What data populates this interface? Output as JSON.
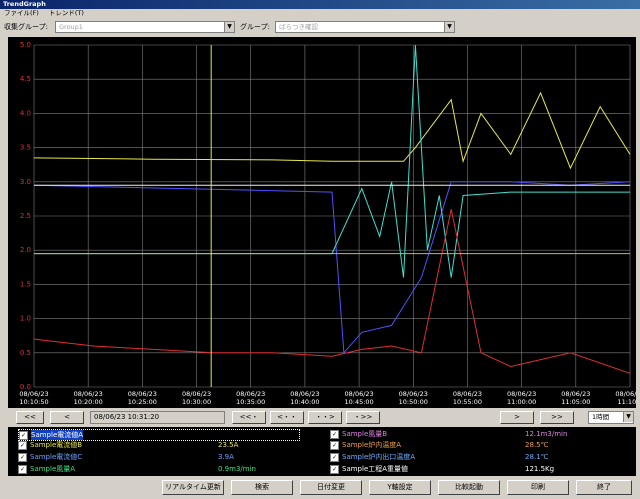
{
  "window": {
    "title": "TrendGraph"
  },
  "menu": [
    "ファイル(F)",
    "トレンド(T)"
  ],
  "toolbar": {
    "collect_group_label": "収集グループ:",
    "collect_group_value": "Group1",
    "group_label": "グループ:",
    "group_value": "ばらつき確認"
  },
  "chart_data": {
    "type": "line",
    "ylim": [
      0,
      5.0
    ],
    "yticks": [
      "0.0",
      "0.5",
      "1.0",
      "1.5",
      "2.0",
      "2.5",
      "3.0",
      "3.5",
      "4.0",
      "4.5",
      "5.0"
    ],
    "xticks": [
      [
        "08/06/23",
        "10:10:50"
      ],
      [
        "08/06/23",
        "10:20:00"
      ],
      [
        "08/06/23",
        "10:25:00"
      ],
      [
        "08/06/23",
        "10:30:00"
      ],
      [
        "08/06/23",
        "10:35:00"
      ],
      [
        "08/06/23",
        "10:40:00"
      ],
      [
        "08/06/23",
        "10:45:00"
      ],
      [
        "08/06/23",
        "10:50:00"
      ],
      [
        "08/06/23",
        "10:55:00"
      ],
      [
        "08/06/23",
        "11:00:00"
      ],
      [
        "08/06/23",
        "11:05:00"
      ],
      [
        "08/06/23",
        "11:10:5"
      ]
    ],
    "cursor_time": "10:31:20",
    "grid": true,
    "series": [
      {
        "name": "Sample電流値B",
        "color": "#e8e84a",
        "x": [
          0,
          0.2,
          0.4,
          0.5,
          0.62,
          0.64,
          0.7,
          0.72,
          0.75,
          0.8,
          0.85,
          0.9,
          0.95,
          1.0
        ],
        "y": [
          3.35,
          3.33,
          3.32,
          3.3,
          3.3,
          3.5,
          4.2,
          3.3,
          4.0,
          3.4,
          4.3,
          3.2,
          4.1,
          3.4
        ]
      },
      {
        "name": "Sample電流値C",
        "color": "#5050ff",
        "x": [
          0,
          0.25,
          0.5,
          0.52,
          0.55,
          0.6,
          0.65,
          0.7,
          0.8,
          0.9,
          1.0
        ],
        "y": [
          2.95,
          2.9,
          2.85,
          0.5,
          0.8,
          0.9,
          1.6,
          3.0,
          3.0,
          2.95,
          3.0
        ]
      },
      {
        "name": "Sample風量A",
        "color": "#40e0d0",
        "x": [
          0,
          0.25,
          0.5,
          0.55,
          0.58,
          0.6,
          0.62,
          0.64,
          0.66,
          0.68,
          0.7,
          0.72,
          0.8,
          1.0
        ],
        "y": [
          1.95,
          1.95,
          1.95,
          2.9,
          2.2,
          3.0,
          1.6,
          5.0,
          2.0,
          2.8,
          1.6,
          2.8,
          2.85,
          2.85
        ]
      },
      {
        "name": "Sample風量B",
        "color": "#e03030",
        "x": [
          0,
          0.1,
          0.2,
          0.3,
          0.4,
          0.5,
          0.55,
          0.6,
          0.65,
          0.7,
          0.75,
          0.8,
          0.9,
          1.0
        ],
        "y": [
          0.7,
          0.6,
          0.55,
          0.5,
          0.5,
          0.45,
          0.55,
          0.6,
          0.5,
          2.6,
          0.5,
          0.3,
          0.5,
          0.2
        ]
      },
      {
        "name": "Sample炉内温度A",
        "color": "#f0f0f0",
        "x": [
          0,
          0.5,
          1.0
        ],
        "y": [
          2.95,
          2.95,
          2.95
        ]
      },
      {
        "name": "Sample炉内出口温度A",
        "color": "#c0c040",
        "x": [
          0,
          0.5,
          1.0
        ],
        "y": [
          1.95,
          1.95,
          1.95
        ]
      }
    ]
  },
  "nav": {
    "first": "<<",
    "prev": "<",
    "date_value": "08/06/23 10:31:20",
    "scroll_left_fast": "<<・",
    "scroll_left": "<・・",
    "scroll_right": "・・>",
    "scroll_right_fast": "・>>",
    "next": ">",
    "last": ">>",
    "range_value": "1時間"
  },
  "legend": [
    {
      "name": "Sample電流値A",
      "value": "",
      "color": "#ffffff",
      "checked": true
    },
    {
      "name": "Sample電流値B",
      "value": "23.5A",
      "color": "#e8e84a",
      "checked": true
    },
    {
      "name": "Sample電流値C",
      "value": "3.9A",
      "color": "#6aa0ff",
      "checked": true
    },
    {
      "name": "Sample風量A",
      "value": "0.9m3/min",
      "color": "#40e080",
      "checked": true
    },
    {
      "name": "Sample風量B",
      "value": "12.1m3/min",
      "color": "#e080e0",
      "checked": true
    },
    {
      "name": "Sample炉内温度A",
      "value": "28.5℃",
      "color": "#f0a040",
      "checked": true
    },
    {
      "name": "Sample炉内出口温度A",
      "value": "28.1℃",
      "color": "#6ab0ff",
      "checked": true
    },
    {
      "name": "Sample工程A重量値",
      "value": "121.5Kg",
      "color": "#ffffff",
      "checked": true
    }
  ],
  "buttons": {
    "realtime": "リアルタイム更新",
    "search": "検索",
    "date_change": "日付変更",
    "y_axis": "Y軸設定",
    "compare": "比較起動",
    "print": "印刷",
    "exit": "終了"
  }
}
